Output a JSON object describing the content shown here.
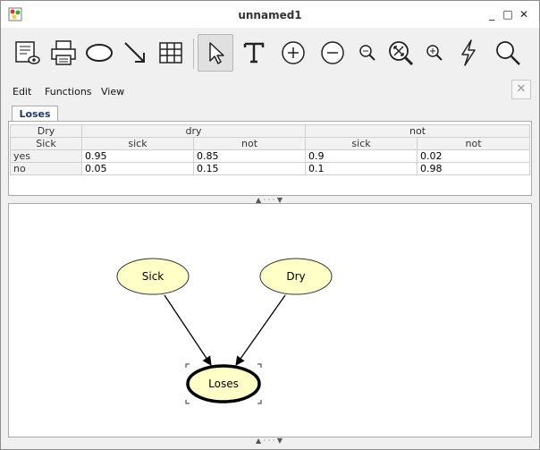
{
  "window": {
    "title": "unnamed1"
  },
  "titlebar": {
    "minimize": "_",
    "maximize": "□",
    "close": "✕"
  },
  "toolbar": {
    "icons": [
      "table-view-icon",
      "print-icon",
      "node-icon",
      "arrow-icon",
      "grid-icon",
      "pointer-icon",
      "text-icon",
      "zoom-in-icon",
      "zoom-out-icon",
      "zoom-small-icon",
      "zoom-fit-icon",
      "zoom-plus-icon",
      "lightning-icon",
      "search-icon"
    ]
  },
  "menu": {
    "items": [
      "Edit",
      "Functions",
      "View"
    ],
    "close": "✕"
  },
  "cpt": {
    "tab": "Loses",
    "var_labels": [
      "Dry",
      "Sick"
    ],
    "dry_states": [
      "dry",
      "not"
    ],
    "sick_states": [
      "sick",
      "not",
      "sick",
      "not"
    ],
    "rows": [
      {
        "label": "yes",
        "values": [
          "0.95",
          "0.85",
          "0.9",
          "0.02"
        ]
      },
      {
        "label": "no",
        "values": [
          "0.05",
          "0.15",
          "0.1",
          "0.98"
        ]
      }
    ]
  },
  "graph": {
    "nodes": [
      {
        "id": "sick",
        "label": "Sick"
      },
      {
        "id": "dry",
        "label": "Dry"
      },
      {
        "id": "loses",
        "label": "Loses"
      }
    ]
  },
  "colors": {
    "node_fill": "#ffffc8",
    "node_stroke": "#333333",
    "accent": "#1c3a6e"
  }
}
